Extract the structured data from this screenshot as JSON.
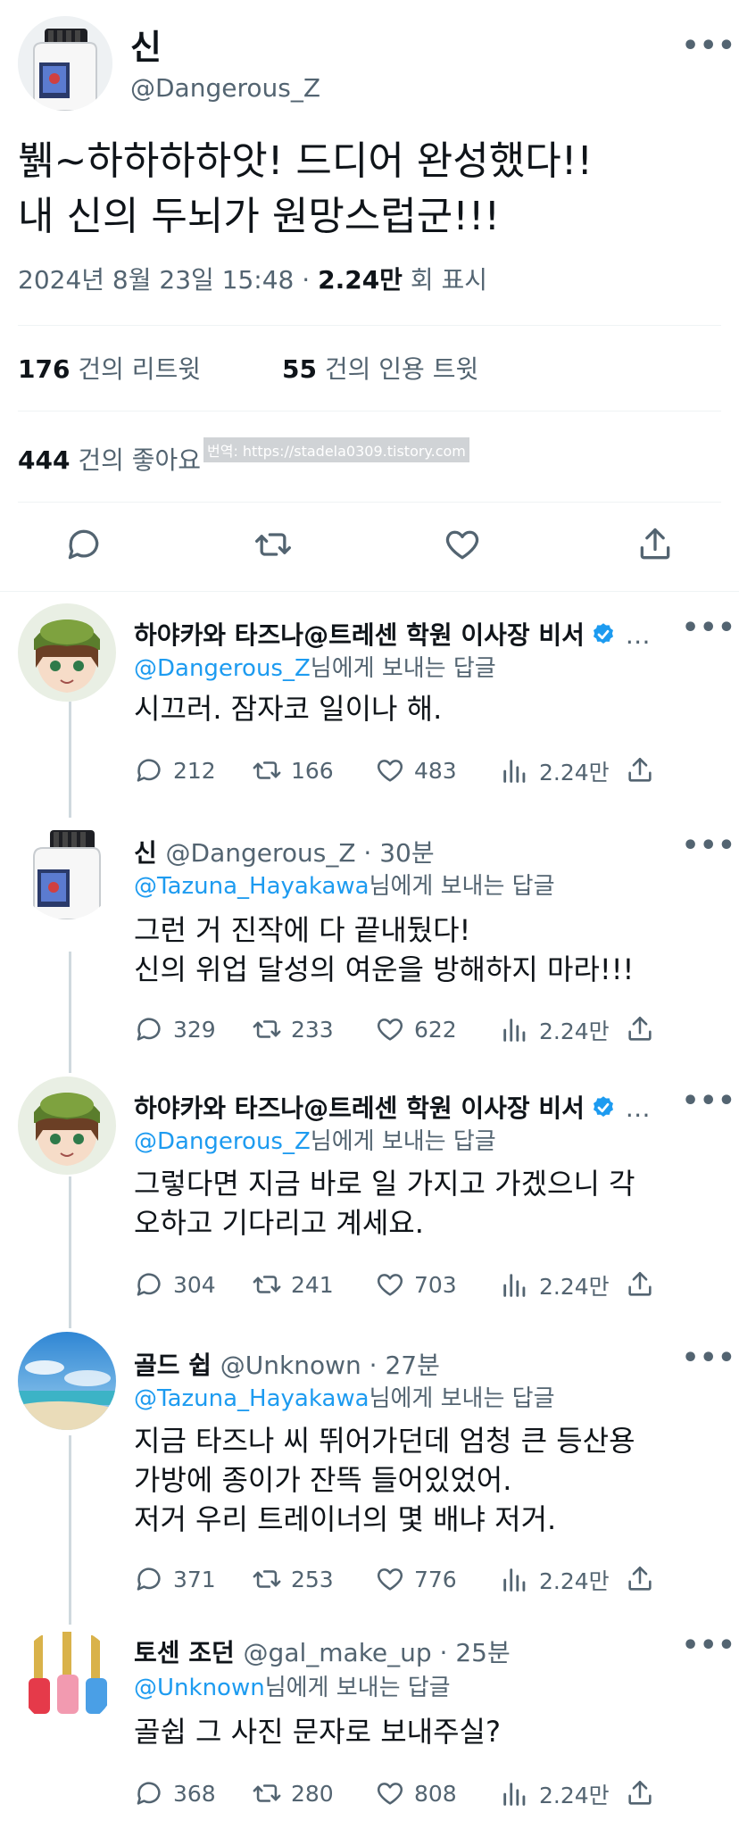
{
  "main": {
    "name": "신",
    "handle": "@Dangerous_Z",
    "text": "뷁~하하하하앗! 드디어 완성했다!!\n내 신의 두뇌가 원망스럽군!!!",
    "date": "2024년 8월 23일  15:48",
    "views_value": "2.24만",
    "views_label": "회 표시",
    "retweets_count": "176",
    "retweets_label": "건의 리트윗",
    "quotes_count": "55",
    "quotes_label": "건의 인용 트윗",
    "likes_count": "444",
    "likes_label": "건의 좋아요",
    "watermark": "번역: https://stadela0309.tistory.com",
    "more": "•••"
  },
  "replies": [
    {
      "name": "하야카와 타즈나@트레센 학원 이사장 비서",
      "handle": "",
      "time": "",
      "reply_to": "@Dangerous_Z",
      "reply_suffix": "님에게 보내는 답글",
      "text": "시끄러. 잠자코 일이나 해.",
      "replies": "212",
      "retweets": "166",
      "likes": "483",
      "views": "2.24만",
      "verified": true
    },
    {
      "name": "신",
      "handle": "@Dangerous_Z · 30분",
      "reply_to": "@Tazuna_Hayakawa",
      "reply_suffix": "님에게 보내는 답글",
      "text": "그런 거 진작에 다 끝내뒀다!\n신의 위업 달성의 여운을 방해하지 마라!!!",
      "replies": "329",
      "retweets": "233",
      "likes": "622",
      "views": "2.24만",
      "verified": false
    },
    {
      "name": "하야카와 타즈나@트레센 학원 이사장 비서",
      "handle": "",
      "reply_to": "@Dangerous_Z",
      "reply_suffix": "님에게 보내는 답글",
      "text": "그렇다면 지금 바로 일 가지고 가겠으니 각\n오하고 기다리고 계세요.",
      "replies": "304",
      "retweets": "241",
      "likes": "703",
      "views": "2.24만",
      "verified": true
    },
    {
      "name": "골드 쉽",
      "handle": "@Unknown · 27분",
      "reply_to": "@Tazuna_Hayakawa",
      "reply_suffix": "님에게 보내는 답글",
      "text": "지금 타즈나 씨 뛰어가던데 엄청 큰 등산용\n가방에 종이가 잔뜩 들어있었어.\n저거 우리 트레이너의 몇 배냐 저거.",
      "replies": "371",
      "retweets": "253",
      "likes": "776",
      "views": "2.24만",
      "verified": false
    },
    {
      "name": "토센 조던",
      "handle": "@gal_make_up · 25분",
      "reply_to": "@Unknown",
      "reply_suffix": "님에게 보내는 답글",
      "text": "골쉽 그 사진 문자로 보내주실?",
      "replies": "368",
      "retweets": "280",
      "likes": "808",
      "views": "2.24만",
      "verified": false
    }
  ],
  "colors": {
    "text": "#0f1419",
    "secondary": "#536471",
    "link": "#1d9bf0",
    "divider": "#eff3f4",
    "verified": "#1d9bf0"
  }
}
